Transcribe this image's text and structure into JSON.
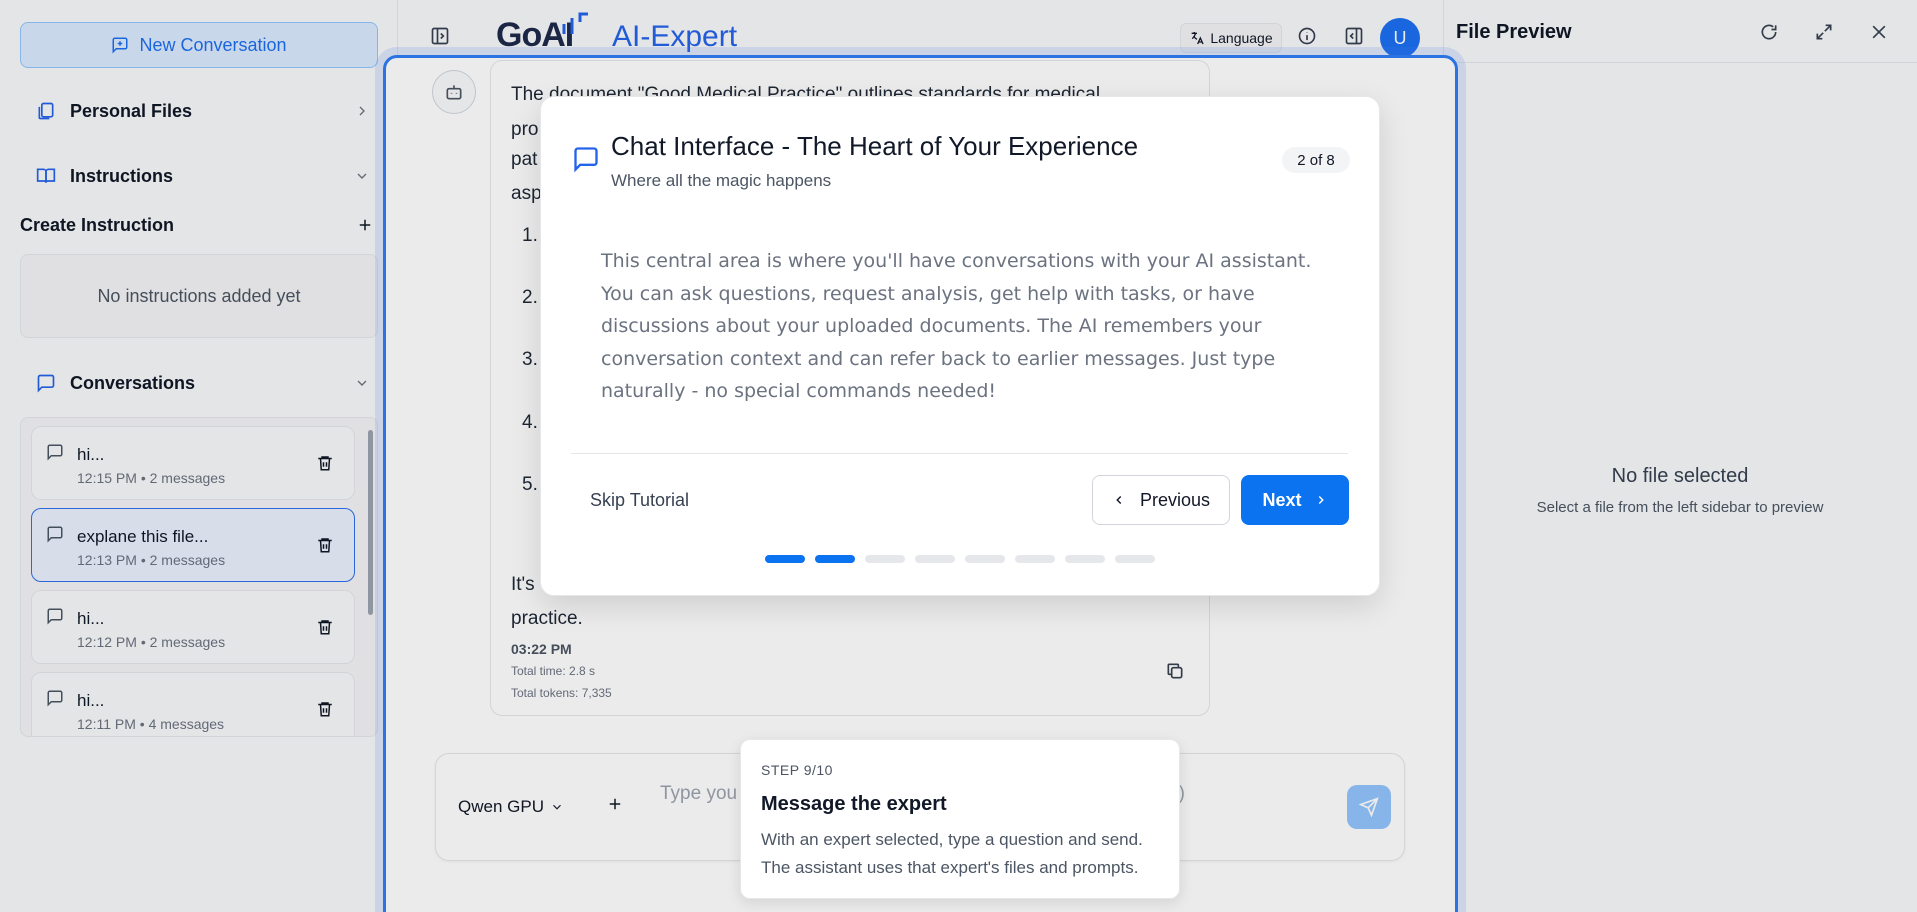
{
  "sidebar": {
    "new_conversation_label": "New Conversation",
    "personal_files_label": "Personal Files",
    "instructions_label": "Instructions",
    "create_instruction_label": "Create Instruction",
    "no_instructions_text": "No instructions added yet",
    "conversations_label": "Conversations",
    "conversations": [
      {
        "title": "hi...",
        "meta": "12:15 PM • 2 messages"
      },
      {
        "title": "explane this file...",
        "meta": "12:13 PM • 2 messages",
        "active": true
      },
      {
        "title": "hi...",
        "meta": "12:12 PM • 2 messages"
      },
      {
        "title": "hi...",
        "meta": "12:11 PM • 4 messages"
      }
    ]
  },
  "header": {
    "logo_text": "GoAI",
    "app_title": "AI-Expert",
    "language_label": "Language",
    "avatar_initial": "U"
  },
  "chat": {
    "message_lines": [
      "The document \"Good Medical Practice\" outlines standards for medical",
      "pro",
      "pat",
      "asp"
    ],
    "list_numbers": [
      "1.",
      "2.",
      "3.",
      "4.",
      "5."
    ],
    "closing_line_1": "It's",
    "closing_line_2": "practice.",
    "time": "03:22 PM",
    "total_time": "Total time: 2.8 s",
    "total_tokens": "Total tokens: 7,335"
  },
  "input": {
    "model_label": "Qwen GPU",
    "placeholder_start": "Type you",
    "placeholder_end": "e)"
  },
  "file_preview": {
    "title": "File Preview",
    "empty_title": "No file selected",
    "empty_subtitle": "Select a file from the left sidebar to preview"
  },
  "tutorial": {
    "title": "Chat Interface - The Heart of Your Experience",
    "subtitle": "Where all the magic happens",
    "badge": "2 of 8",
    "body": "This central area is where you'll have conversations with your AI assistant. You can ask questions, request analysis, get help with tasks, or have discussions about your uploaded documents. The AI remembers your conversation context and can refer back to earlier messages. Just type naturally - no special commands needed!",
    "skip_label": "Skip Tutorial",
    "previous_label": "Previous",
    "next_label": "Next",
    "total_steps": 8,
    "current_step": 2
  },
  "step_popover": {
    "step_label": "STEP 9/10",
    "title": "Message the expert",
    "description": "With an expert selected, type a question and send. The assistant uses that expert's files and prompts."
  },
  "colors": {
    "accent": "#0b72f0",
    "brand_blue": "#2563eb"
  }
}
